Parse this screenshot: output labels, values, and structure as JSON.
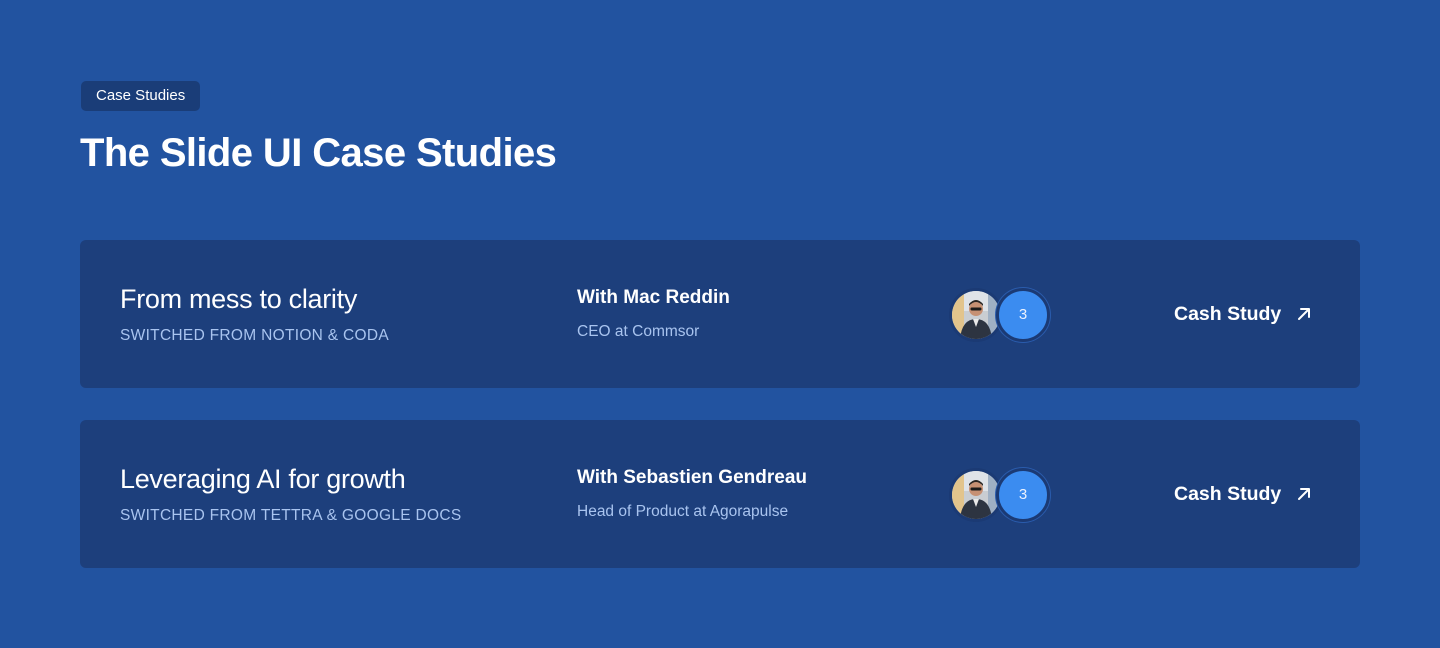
{
  "header": {
    "badge": "Case Studies",
    "title": "The Slide UI Case Studies"
  },
  "cards": [
    {
      "title": "From mess to clarity",
      "subtitle": "SWITCHED FROM NOTION & CODA",
      "person_name": "With Mac Reddin",
      "person_role": "CEO at Commsor",
      "avatar_icon": "person-avatar",
      "count": "3",
      "cta_label": "Cash Study",
      "cta_icon": "arrow-up-right-icon"
    },
    {
      "title": "Leveraging AI for growth",
      "subtitle": "SWITCHED FROM TETTRA & GOOGLE DOCS",
      "person_name": "With Sebastien Gendreau",
      "person_role": "Head of Product at Agorapulse",
      "avatar_icon": "person-avatar",
      "count": "3",
      "cta_label": "Cash Study",
      "cta_icon": "arrow-up-right-icon"
    }
  ],
  "colors": {
    "background": "#2253a0",
    "card": "#1d3f7c",
    "badge": "#1a3d78",
    "accent": "#3b8cf0",
    "muted_text": "#a9c4ef"
  }
}
